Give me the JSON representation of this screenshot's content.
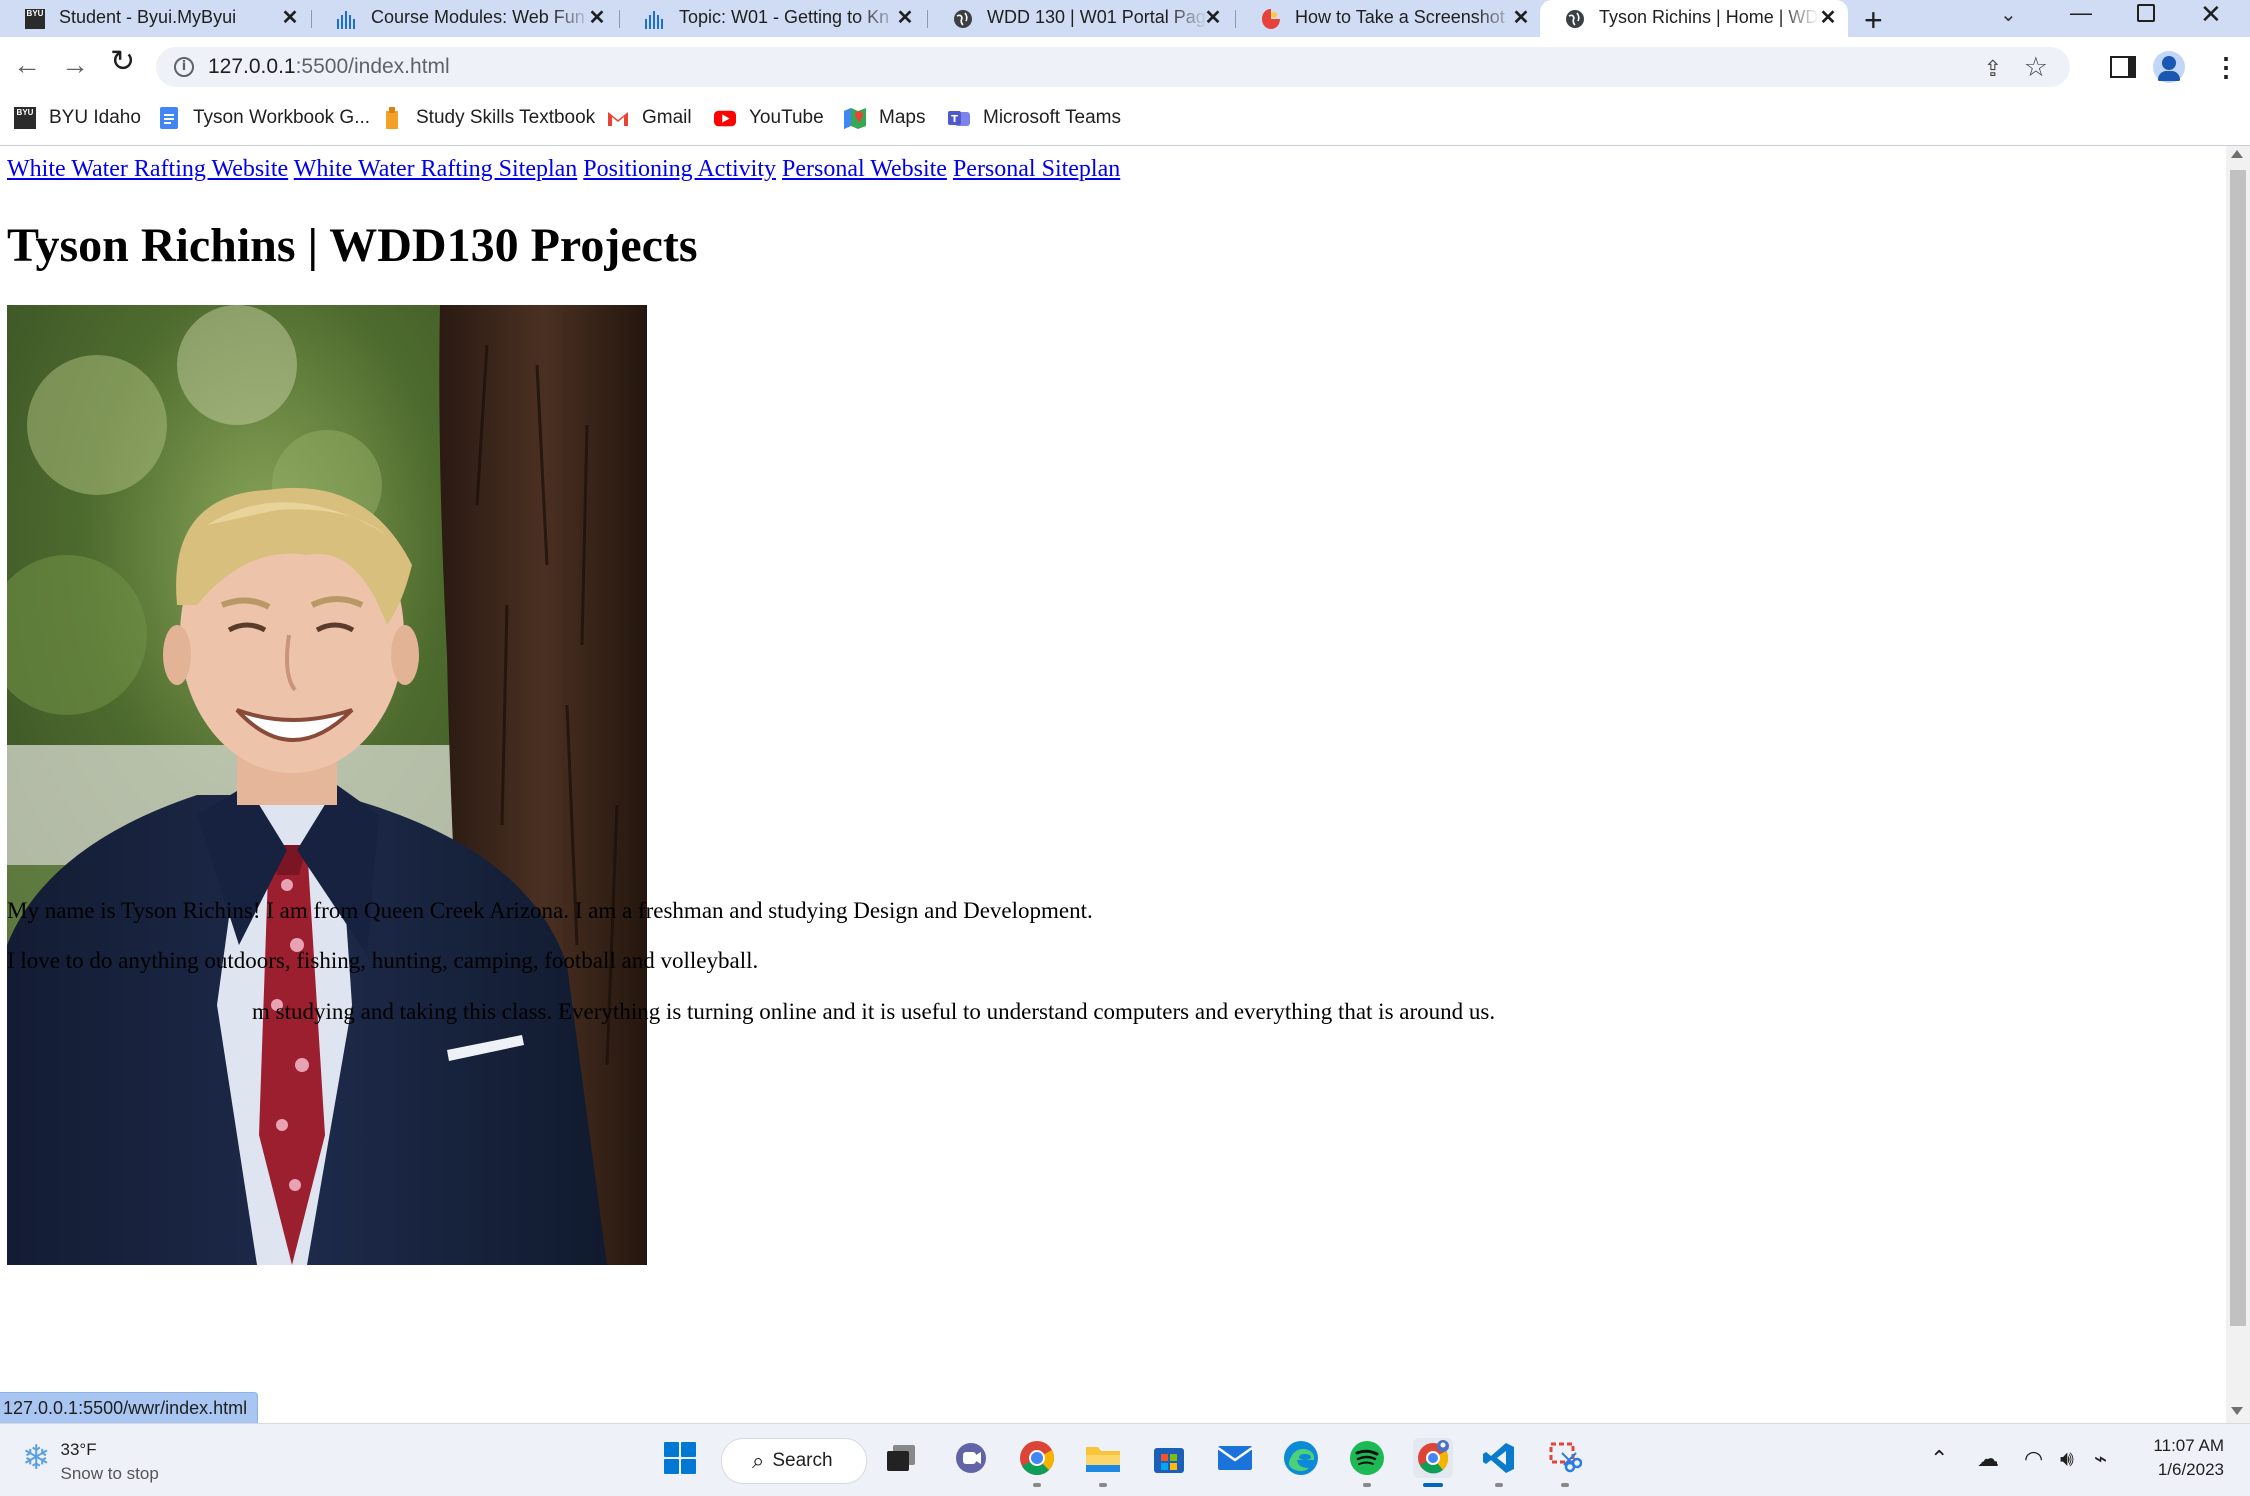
{
  "browser": {
    "tabs": [
      {
        "title": "Student - Byui.MyByui",
        "icon": "byu-icon",
        "active": false
      },
      {
        "title": "Course Modules: Web Fun",
        "icon": "canvas-icon",
        "active": false
      },
      {
        "title": "Topic: W01 - Getting to Kn",
        "icon": "canvas-icon",
        "active": false
      },
      {
        "title": "WDD 130 | W01 Portal Pag",
        "icon": "globe-icon",
        "active": false
      },
      {
        "title": "How to Take a Screenshot",
        "icon": "scribe-icon",
        "active": false
      },
      {
        "title": "Tyson Richins | Home | WD",
        "icon": "globe-icon",
        "active": true
      }
    ],
    "address": {
      "host": "127.0.0.1",
      "path": ":5500/index.html"
    },
    "bookmarks": [
      {
        "label": "BYU Idaho",
        "icon": "byu-icon"
      },
      {
        "label": "Tyson Workbook G...",
        "icon": "docs-icon"
      },
      {
        "label": "Study Skills Textbook",
        "icon": "textbook-icon"
      },
      {
        "label": "Gmail",
        "icon": "gmail-icon"
      },
      {
        "label": "YouTube",
        "icon": "youtube-icon"
      },
      {
        "label": "Maps",
        "icon": "maps-icon"
      },
      {
        "label": "Microsoft Teams",
        "icon": "teams-icon"
      }
    ],
    "status_url": "127.0.0.1:5500/wwr/index.html"
  },
  "page": {
    "nav": [
      "White Water Rafting Website",
      "White Water Rafting Siteplan",
      "Positioning Activity",
      "Personal Website",
      "Personal Siteplan"
    ],
    "heading": "Tyson Richins | WDD130 Projects",
    "paragraphs": [
      "My name is Tyson Richins! I am from Queen Creek Arizona. I am a freshman and studying Design and Development.",
      "I love to do anything outdoors, fishing, hunting, camping, football and volleyball.",
      "m studying and taking this class. Everything is turning online and it is useful to understand computers and everything that is around us."
    ]
  },
  "taskbar": {
    "weather": {
      "temp": "33°F",
      "desc": "Snow to stop"
    },
    "search_label": "Search",
    "apps": [
      "windows-start-icon",
      "task-view-icon",
      "teams-chat-icon",
      "chrome-icon",
      "file-explorer-icon",
      "microsoft-store-icon",
      "mail-icon",
      "edge-icon",
      "spotify-icon",
      "chrome-profile-icon",
      "vscode-icon",
      "snipping-tool-icon"
    ],
    "clock": {
      "time": "11:07 AM",
      "date": "1/6/2023"
    }
  },
  "colors": {
    "accent": "#0067c0",
    "link": "#0000ee",
    "tabstrip": "#cfdcf3"
  }
}
